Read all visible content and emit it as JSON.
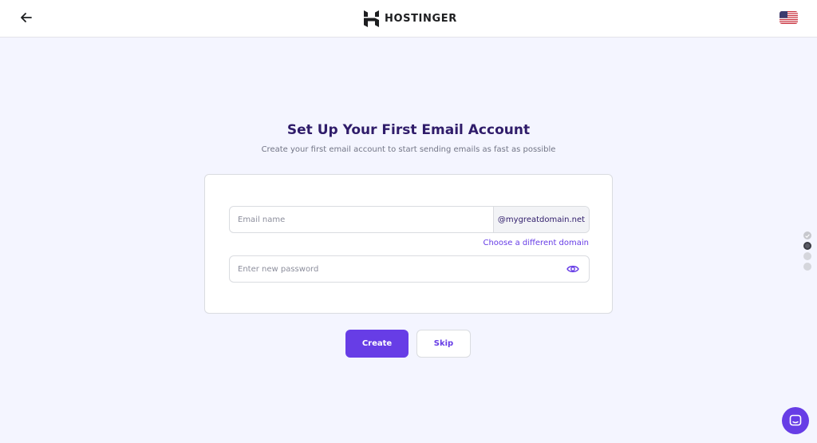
{
  "header": {
    "brand": "HOSTINGER",
    "language_flag": "us-flag-icon"
  },
  "main": {
    "title": "Set Up Your First Email Account",
    "subtitle": "Create your first email account to start sending emails as fast as possible"
  },
  "form": {
    "email_placeholder": "Email name",
    "email_value": "",
    "domain_suffix": "@mygreatdomain.net",
    "change_domain_label": "Choose a different domain",
    "password_placeholder": "Enter new password",
    "password_value": ""
  },
  "actions": {
    "create_label": "Create",
    "skip_label": "Skip"
  },
  "steps": [
    "done",
    "active",
    "pending",
    "pending"
  ],
  "colors": {
    "accent": "#673de6",
    "title": "#2f1c6a",
    "background": "#f4f5ff"
  }
}
